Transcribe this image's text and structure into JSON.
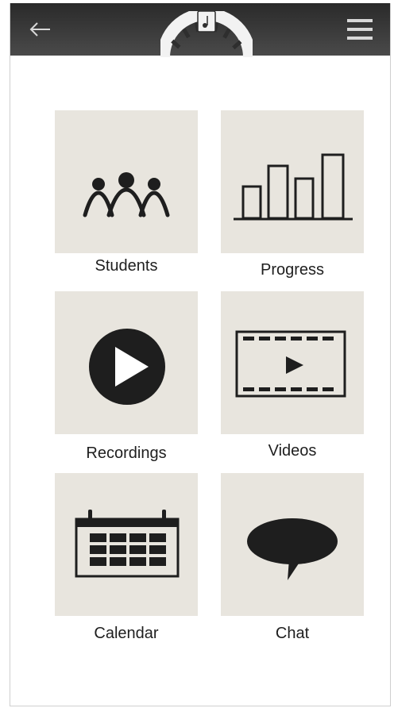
{
  "header": {
    "back_icon": "arrow-left-icon",
    "menu_icon": "hamburger-menu-icon",
    "logo_icon": "piano-keys-logo"
  },
  "tiles": [
    {
      "label": "Students",
      "icon": "people-group-icon"
    },
    {
      "label": "Progress",
      "icon": "bar-chart-icon"
    },
    {
      "label": "Recordings",
      "icon": "play-circle-icon"
    },
    {
      "label": "Videos",
      "icon": "film-strip-play-icon"
    },
    {
      "label": "Calendar",
      "icon": "calendar-icon"
    },
    {
      "label": "Chat",
      "icon": "speech-bubble-icon"
    }
  ],
  "colors": {
    "header": "#3a3a3a",
    "tile_background": "#e8e5de",
    "icon": "#1e1e1e"
  }
}
